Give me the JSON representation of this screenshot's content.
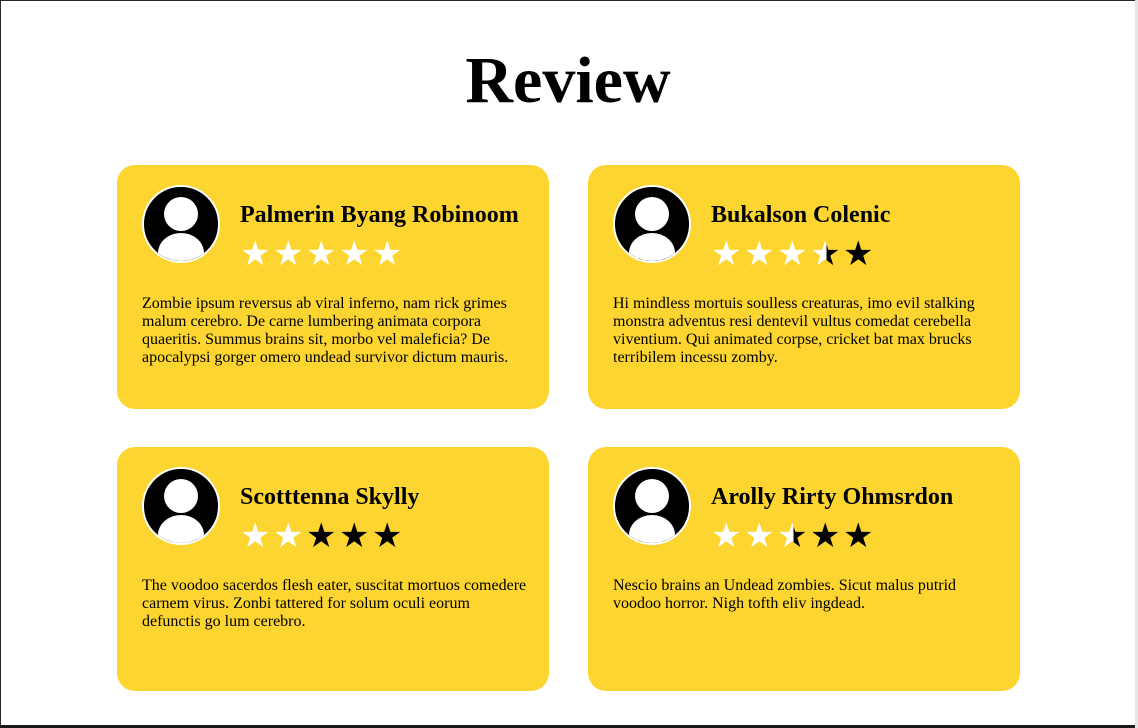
{
  "page": {
    "title": "Review"
  },
  "colors": {
    "card_background": "#fdd531",
    "star_filled": "#ffffff",
    "star_empty": "#000000"
  },
  "icons": {
    "avatar": "user-avatar-icon",
    "star": "star-icon"
  },
  "reviews": [
    {
      "name": "Palmerin Byang Robinoom",
      "rating": 5,
      "rating_max": 5,
      "text": "Zombie ipsum reversus ab viral inferno, nam rick grimes malum cerebro. De carne lumbering animata corpora quaeritis. Summus brains sit, morbo vel maleficia? De apocalypsi gorger omero undead survivor dictum mauris."
    },
    {
      "name": "Bukalson Colenic",
      "rating": 3.5,
      "rating_max": 5,
      "text": "Hi mindless mortuis soulless creaturas, imo evil stalking monstra adventus resi dentevil vultus comedat cerebella viventium. Qui animated corpse, cricket bat max brucks terribilem incessu zomby."
    },
    {
      "name": "Scotttenna Skylly",
      "rating": 2,
      "rating_max": 5,
      "text": "The voodoo sacerdos flesh eater, suscitat mortuos comedere carnem virus. Zonbi tattered for solum oculi eorum defunctis go lum cerebro."
    },
    {
      "name": "Arolly Rirty Ohmsrdon",
      "rating": 2.5,
      "rating_max": 5,
      "text": "Nescio brains an Undead zombies. Sicut malus putrid voodoo horror. Nigh tofth eliv ingdead."
    }
  ]
}
